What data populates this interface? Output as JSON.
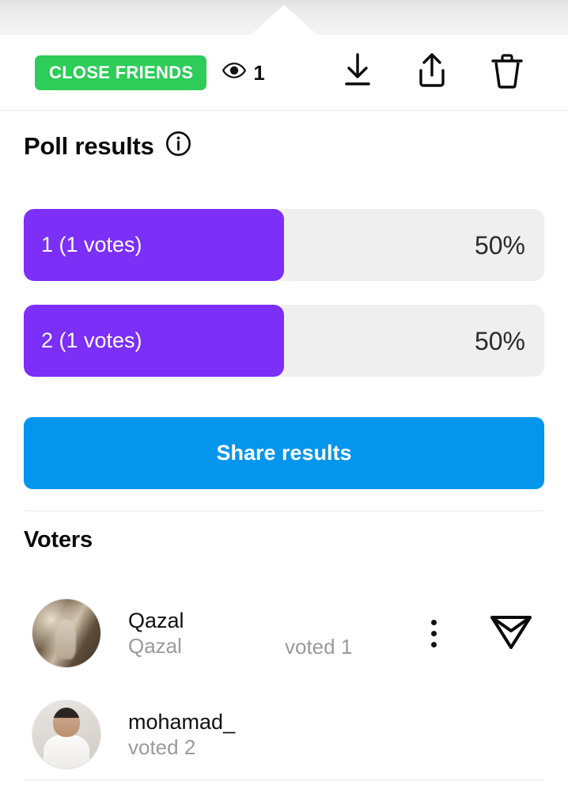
{
  "story_header": {
    "badge_label": "CLOSE FRIENDS",
    "badge_color": "#2ecc58",
    "views_icon": "eye-icon",
    "views_count": "1",
    "actions": [
      {
        "name": "download-icon",
        "label": "Download"
      },
      {
        "name": "share-icon",
        "label": "Share"
      },
      {
        "name": "delete-icon",
        "label": "Delete"
      }
    ]
  },
  "poll": {
    "title": "Poll results",
    "info_icon": "info-icon",
    "accent_color": "#7B2FF7",
    "track_color": "#efefef",
    "options": [
      {
        "label": "1 (1 votes)",
        "percent": "50%",
        "fill": 50
      },
      {
        "label": "2 (1 votes)",
        "percent": "50%",
        "fill": 50
      }
    ],
    "share_button": {
      "label": "Share results",
      "color": "#0495ed"
    }
  },
  "voters": {
    "title": "Voters",
    "list": [
      {
        "avatar": "avatar-qazal",
        "name": "Qazal",
        "username": "Qazal",
        "voted": "voted 1",
        "menu_icon": "more-options-icon",
        "send_icon": "direct-message-icon"
      },
      {
        "avatar": "avatar-mohamad",
        "name": "mohamad_",
        "username": "voted 2",
        "voted": "",
        "menu_icon": "",
        "send_icon": ""
      }
    ]
  }
}
